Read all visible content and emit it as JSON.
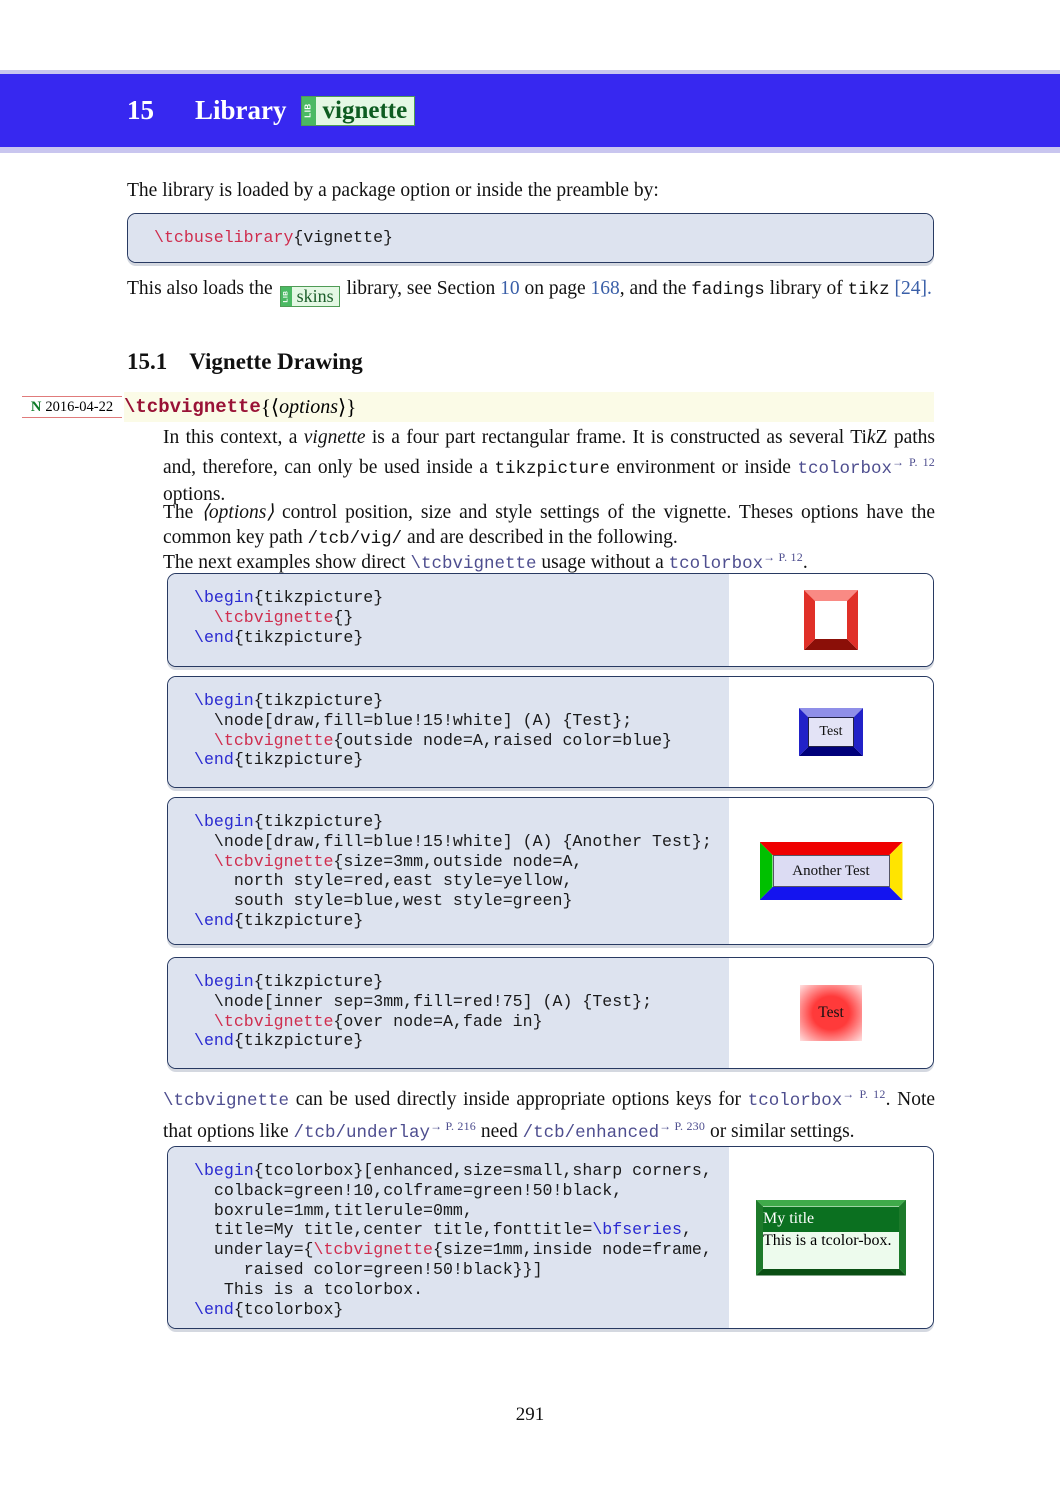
{
  "header": {
    "chapter_number": "15",
    "chapter_word": "Library",
    "lib_tag": "LIB",
    "library_name": "vignette"
  },
  "intro": {
    "line1": "The library is loaded by a package option or inside the preamble by:"
  },
  "code_preamble": {
    "command": "\\tcbuselibrary",
    "argument": "{vignette}"
  },
  "loads_note": {
    "part1": "This also loads the",
    "lib_tag": "LIB",
    "skins_name": "skins",
    "part2": "library, see Section",
    "section_ref": "10",
    "part3": "on page",
    "page_ref": "168",
    "part4": ", and the",
    "fadings": "fadings",
    "part5": "library of",
    "tikz": "tikz",
    "citation": "[24]."
  },
  "section": {
    "number": "15.1",
    "title": "Vignette Drawing"
  },
  "command_entry": {
    "marker_letter": "N",
    "marker_date": "2016-04-22",
    "name": "\\tcbvignette",
    "open_brace": "{",
    "arg_open": "⟨",
    "arg": "options",
    "arg_close": "⟩",
    "close_brace": "}"
  },
  "description": {
    "p1_a": "In this context, a",
    "p1_vignette": "vignette",
    "p1_b": "is a four part rectangular frame.  It is constructed as several",
    "p2_a": "Ti",
    "p2_k": "k",
    "p2_Z": "Z",
    "p2_b": "paths and, therefore, can only be used inside a",
    "p2_tikzpicture": "tikzpicture",
    "p2_c": "environment or inside",
    "p3_tcolorbox": "tcolorbox",
    "p3_ref": "→ P. 12",
    "p3_b": "options.",
    "p4_a": "The",
    "p4_opt": "⟨options⟩",
    "p4_b": "control position, size and style settings of the vignette.  Theses options have",
    "p5_a": "the common key path",
    "p5_path": "/tcb/vig/",
    "p5_b": "and are described in the following.",
    "p6_a": "The next examples show direct",
    "p6_cmd": "\\tcbvignette",
    "p6_b": "usage without a",
    "p6_tcolorbox": "tcolorbox",
    "p6_ref": "→ P. 12",
    "p6_c": "."
  },
  "examples": [
    {
      "name": "example-basic-vignette",
      "code_lines": [
        [
          {
            "t": "\\begin",
            "c": "blue"
          },
          {
            "t": "{tikzpicture}",
            "c": "plain"
          }
        ],
        [
          {
            "t": "  ",
            "c": "plain"
          },
          {
            "t": "\\tcbvignette",
            "c": "red"
          },
          {
            "t": "{}",
            "c": "plain"
          }
        ],
        [
          {
            "t": "\\end",
            "c": "blue"
          },
          {
            "t": "{tikzpicture}",
            "c": "plain"
          }
        ]
      ],
      "result": {
        "kind": "frame-empty",
        "north": "#f98a84",
        "east": "#e03028",
        "south": "#8b0f08",
        "west": "#e03028",
        "inner_fill": "#ffffff",
        "label": ""
      }
    },
    {
      "name": "example-outside-node-raised-blue",
      "code_lines": [
        [
          {
            "t": "\\begin",
            "c": "blue"
          },
          {
            "t": "{tikzpicture}",
            "c": "plain"
          }
        ],
        [
          {
            "t": "  \\node[draw,fill=blue!15!white] (A) {Test};",
            "c": "plain"
          }
        ],
        [
          {
            "t": "  ",
            "c": "plain"
          },
          {
            "t": "\\tcbvignette",
            "c": "red"
          },
          {
            "t": "{outside node=A,raised color=blue}",
            "c": "plain"
          }
        ],
        [
          {
            "t": "\\end",
            "c": "blue"
          },
          {
            "t": "{tikzpicture}",
            "c": "plain"
          }
        ]
      ],
      "result": {
        "kind": "frame-node",
        "north": "#8f8fe8",
        "east": "#2222c8",
        "south": "#00007a",
        "west": "#2222c8",
        "inner_fill": "#e3e3f6",
        "inner_border": "#222244",
        "label": "Test"
      }
    },
    {
      "name": "example-four-colored-sides",
      "code_lines": [
        [
          {
            "t": "\\begin",
            "c": "blue"
          },
          {
            "t": "{tikzpicture}",
            "c": "plain"
          }
        ],
        [
          {
            "t": "  \\node[draw,fill=blue!15!white] (A) {Another Test};",
            "c": "plain"
          }
        ],
        [
          {
            "t": "  ",
            "c": "plain"
          },
          {
            "t": "\\tcbvignette",
            "c": "red"
          },
          {
            "t": "{size=3mm,outside node=A,",
            "c": "plain"
          }
        ],
        [
          {
            "t": "    north style=red,east style=yellow,",
            "c": "plain"
          }
        ],
        [
          {
            "t": "    south style=blue,west style=green}",
            "c": "plain"
          }
        ],
        [
          {
            "t": "\\end",
            "c": "blue"
          },
          {
            "t": "{tikzpicture}",
            "c": "plain"
          }
        ]
      ],
      "result": {
        "kind": "frame-node",
        "north": "#ef0000",
        "east": "#ffe400",
        "south": "#1414ef",
        "west": "#00c000",
        "inner_fill": "#dcdcf3",
        "inner_border": "#555566",
        "label": "Another Test"
      }
    },
    {
      "name": "example-over-node-fade-in",
      "code_lines": [
        [
          {
            "t": "\\begin",
            "c": "blue"
          },
          {
            "t": "{tikzpicture}",
            "c": "plain"
          }
        ],
        [
          {
            "t": "  \\node[inner sep=3mm,fill=red!75] (A) {Test};",
            "c": "plain"
          }
        ],
        [
          {
            "t": "  ",
            "c": "plain"
          },
          {
            "t": "\\tcbvignette",
            "c": "red"
          },
          {
            "t": "{over node=A,fade in}",
            "c": "plain"
          }
        ],
        [
          {
            "t": "\\end",
            "c": "blue"
          },
          {
            "t": "{tikzpicture}",
            "c": "plain"
          }
        ]
      ],
      "result": {
        "kind": "fade",
        "fill": "#ff3a3a",
        "label": "Test"
      }
    }
  ],
  "middle_note": {
    "l1_cmd": "\\tcbvignette",
    "l1_a": "can be used directly inside appropriate options keys for",
    "l1_tcolorbox": "tcolorbox",
    "l1_ref": "→ P. 12",
    "l1_b": ".",
    "l2_a": "Note that options like",
    "l2_underlay": "/tcb/underlay",
    "l2_ref1": "→ P. 216",
    "l2_b": "need",
    "l2_enhanced": "/tcb/enhanced",
    "l2_ref2": "→ P. 230",
    "l2_c": "or similar settings."
  },
  "final_example": {
    "name": "example-tcolorbox-underlay-vignette",
    "code_lines": [
      [
        {
          "t": "\\begin",
          "c": "blue"
        },
        {
          "t": "{tcolorbox}[enhanced,size=small,sharp corners,",
          "c": "plain"
        }
      ],
      [
        {
          "t": "  colback=green!10,colframe=green!50!black,",
          "c": "plain"
        }
      ],
      [
        {
          "t": "  boxrule=1mm,titlerule=0mm,",
          "c": "plain"
        }
      ],
      [
        {
          "t": "  title=My title,center title,fonttitle=",
          "c": "plain"
        },
        {
          "t": "\\bfseries",
          "c": "blue"
        },
        {
          "t": ",",
          "c": "plain"
        }
      ],
      [
        {
          "t": "  underlay={",
          "c": "plain"
        },
        {
          "t": "\\tcbvignette",
          "c": "red"
        },
        {
          "t": "{size=1mm,inside node=frame,",
          "c": "plain"
        }
      ],
      [
        {
          "t": "     raised color=green!50!black}}]",
          "c": "plain"
        }
      ],
      [
        {
          "t": "   This is a tcolorbox.",
          "c": "plain"
        }
      ],
      [
        {
          "t": "\\end",
          "c": "blue"
        },
        {
          "t": "{tcolorbox}",
          "c": "plain"
        }
      ]
    ],
    "result": {
      "kind": "tcolorbox",
      "title": "My title",
      "body": "This is a tcolor-box.",
      "frame_north": "#3faa4a",
      "frame_east": "#1d7a2a",
      "frame_south": "#0a4f14",
      "frame_west": "#1d7a2a",
      "title_bg": "#0b7020",
      "body_bg": "#edfbed",
      "title_color": "#ffffff"
    }
  },
  "footer": {
    "page_number": "291"
  },
  "colors": {
    "banner": "#3728f0",
    "code_bg": "#dde3ef",
    "code_border": "#283a62",
    "highlight_yellow": "#fbfbe7",
    "link": "#3a5fa8",
    "macro_red": "#991236",
    "lib_green": "#4bb963"
  }
}
